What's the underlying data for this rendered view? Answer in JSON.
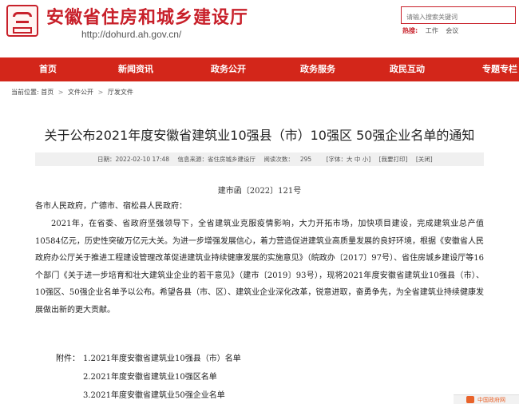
{
  "header": {
    "title": "安徽省住房和城乡建设厅",
    "url": "http://dohurd.ah.gov.cn/",
    "search": {
      "placeholder": "请输入搜索关键词"
    },
    "hot": {
      "label": "热搜:",
      "items": [
        "工作",
        "会议"
      ]
    }
  },
  "nav": {
    "items": [
      "首页",
      "新闻资讯",
      "政务公开",
      "政务服务",
      "政民互动",
      "专题专栏"
    ]
  },
  "breadcrumb": {
    "prefix": "当前位置:",
    "items": [
      "首页",
      "文件公开",
      "厅发文件"
    ]
  },
  "article": {
    "title": "关于公布2021年度安徽省建筑业10强县（市）10强区 50强企业名单的通知",
    "meta": {
      "date": "日期：2022-02-10 17:48",
      "source": "信息来源：省住房城乡建设厅",
      "views_label": "阅读次数：",
      "views": "295",
      "font": "[字体：大 中 小]",
      "print": "[我要打印]",
      "close": "[关闭]"
    },
    "doc_no": "建市函〔2022〕121号",
    "salutation": "各市人民政府，广德市、宿松县人民政府：",
    "paragraph": "2021年，在省委、省政府坚强领导下，全省建筑业克服疫情影响，大力开拓市场，加快项目建设，完成建筑业总产值10584亿元，历史性突破万亿元大关。为进一步增强发展信心，着力营造促进建筑业高质量发展的良好环境，根据《安徽省人民政府办公厅关于推进工程建设管理改革促进建筑业持续健康发展的实施意见》（皖政办〔2017〕97号）、省住房城乡建设厅等16个部门《关于进一步培育和壮大建筑业企业的若干意见》（建市〔2019〕93号），现将2021年度安徽省建筑业10强县（市）、10强区、50强企业名单予以公布。希望各县（市、区）、建筑业企业深化改革，锐意进取，奋勇争先，为全省建筑业持续健康发展做出新的更大贡献。",
    "attachments": {
      "label": "附件：",
      "items": [
        "1.2021年度安徽省建筑业10强县（市）名单",
        "2.2021年度安徽省建筑业10强区名单",
        "3.2021年度安徽省建筑业50强企业名单"
      ]
    }
  },
  "badge": {
    "text": "中国政府网"
  },
  "colors": {
    "brand_red": "#d3261a",
    "title_red": "#c8202a",
    "badge_orange": "#e9632a"
  }
}
